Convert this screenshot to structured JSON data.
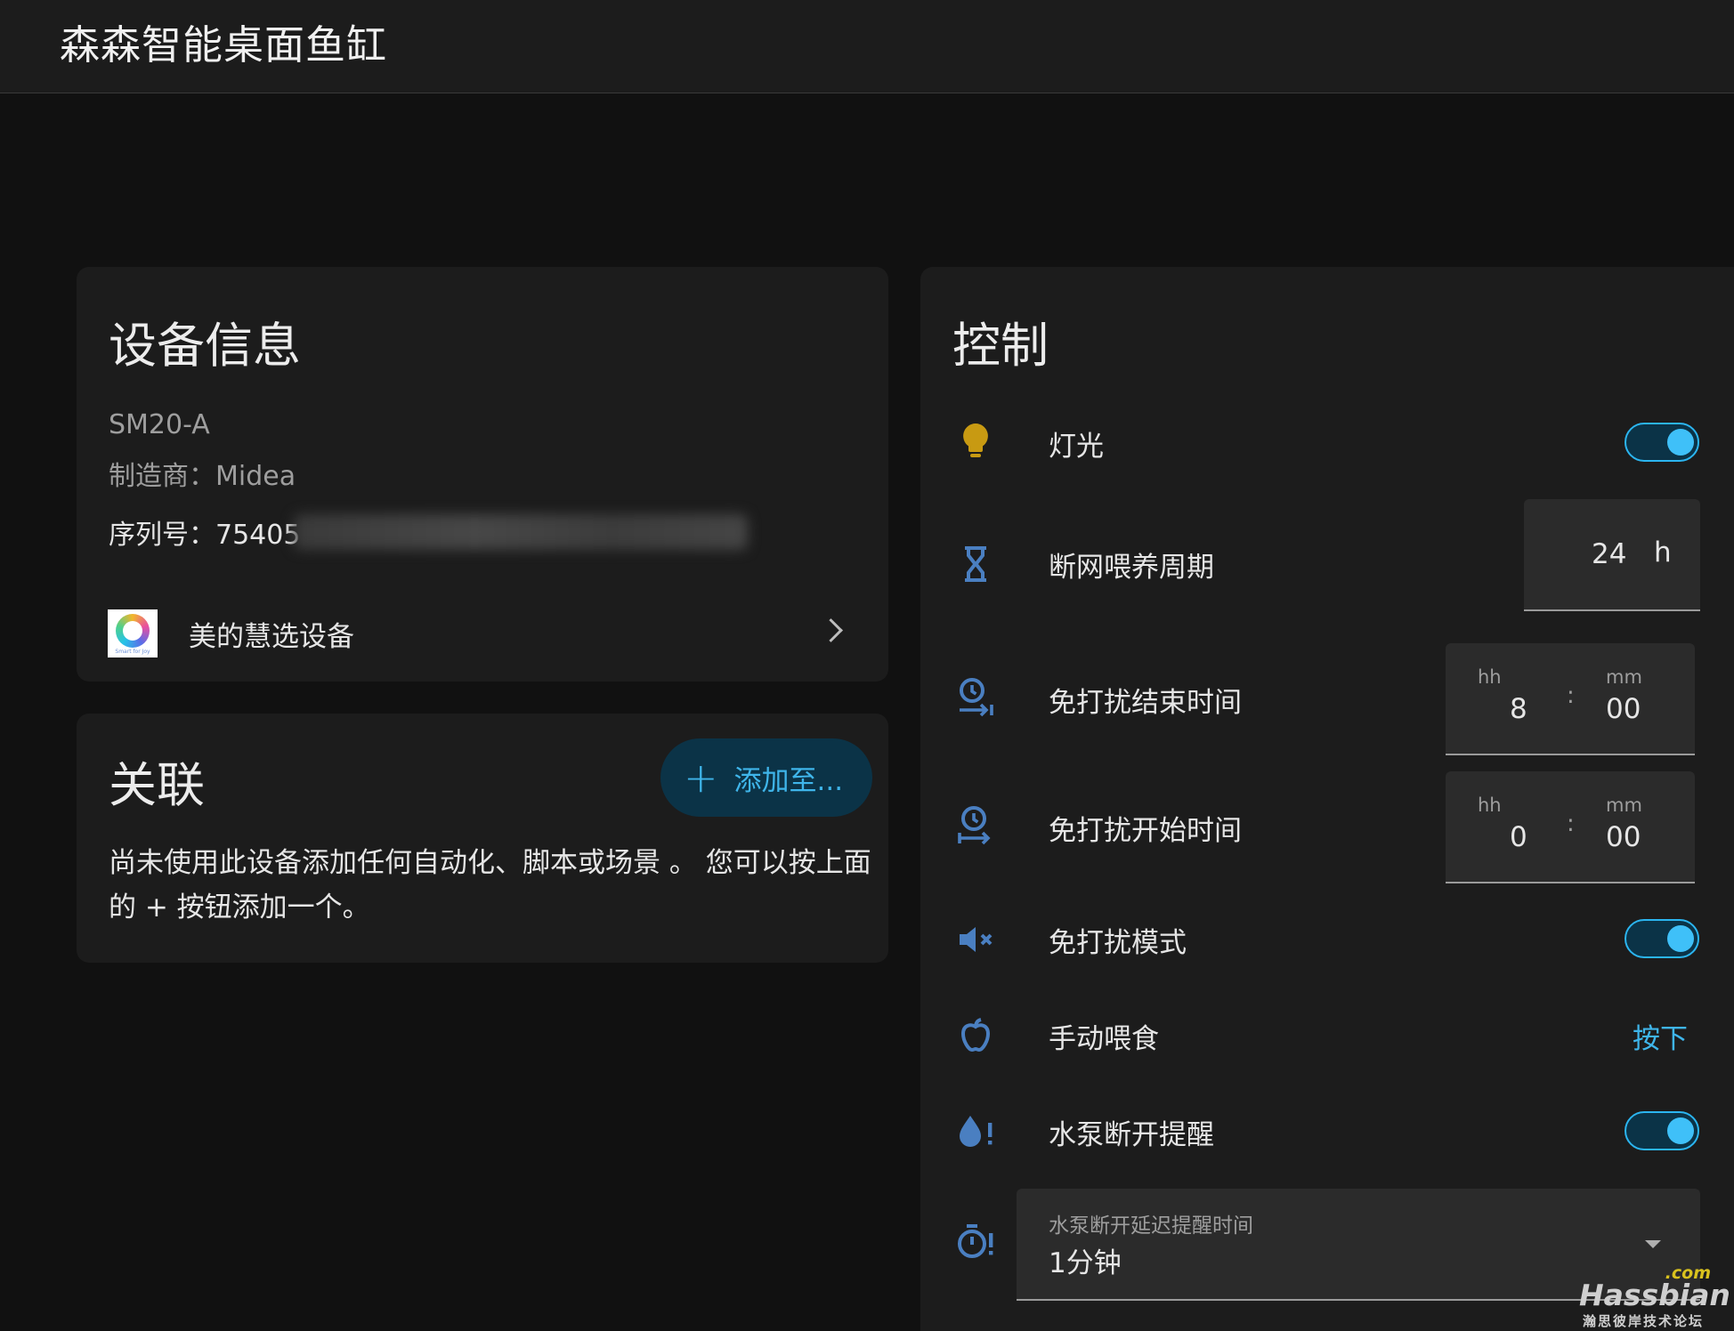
{
  "header": {
    "title": "森森智能桌面鱼缸"
  },
  "device_info": {
    "title": "设备信息",
    "model": "SM20-A",
    "manufacturer": "制造商：Midea",
    "serial": "序列号：75405",
    "integration": {
      "name": "美的慧选设备",
      "logo_tagline": "Smart for Joy"
    }
  },
  "related": {
    "title": "关联",
    "add_button_label": "添加至...",
    "add_icon": "plus-icon",
    "empty_text": "尚未使用此设备添加任何自动化、脚本或场景 。 您可以按上面的 + 按钮添加一个。"
  },
  "controls": {
    "title": "控制",
    "light": {
      "label": "灯光",
      "icon": "lightbulb-icon",
      "on": true
    },
    "offline_feed_cycle": {
      "label": "断网喂养周期",
      "icon": "hourglass-icon",
      "value": "24",
      "unit": "h"
    },
    "dnd_end_time": {
      "label": "免打扰结束时间",
      "icon": "clock-end-icon",
      "hh_label": "hh",
      "mm_label": "mm",
      "hh": "8",
      "mm": "00",
      "separator": ":"
    },
    "dnd_start_time": {
      "label": "免打扰开始时间",
      "icon": "clock-start-icon",
      "hh_label": "hh",
      "mm_label": "mm",
      "hh": "0",
      "mm": "00",
      "separator": ":"
    },
    "dnd_mode": {
      "label": "免打扰模式",
      "icon": "volume-off-icon",
      "on": true
    },
    "manual_feed": {
      "label": "手动喂食",
      "icon": "apple-icon",
      "button_label": "按下"
    },
    "pump_off_alert": {
      "label": "水泵断开提醒",
      "icon": "water-alert-icon",
      "on": true
    },
    "pump_delay": {
      "field_label": "水泵断开延迟提醒时间",
      "icon": "timer-alert-icon",
      "value": "1分钟"
    }
  },
  "watermark": {
    "suffix": ".com",
    "brand": "Hassbian",
    "subtitle": "瀚思彼岸技术论坛"
  },
  "colors": {
    "accent": "#3fb5ea",
    "icon_blue": "#4a7fc1",
    "bulb_yellow": "#c89a12",
    "card": "#1c1c1c",
    "background": "#111111"
  }
}
